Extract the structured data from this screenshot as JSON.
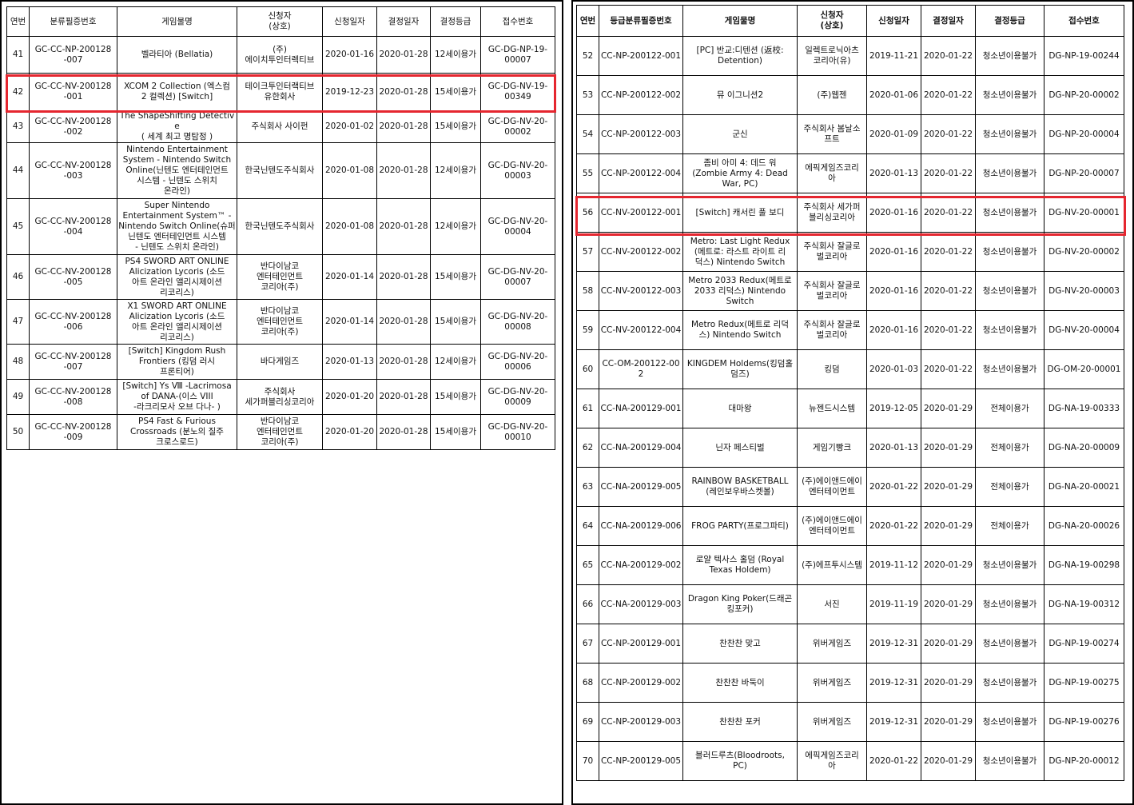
{
  "left": {
    "headers": [
      "연번",
      "분류필증번호",
      "게임물명",
      "신청자\n(상호)",
      "신청일자",
      "결정일자",
      "결정등급",
      "접수번호"
    ],
    "rows": [
      [
        "41",
        "GC-CC-NP-200128\n-007",
        "벨라티아 (Bellatia)",
        "(주)\n에이치투인터렉티브",
        "2020-01-16",
        "2020-01-28",
        "12세이용가",
        "GC-DG-NP-19-\n00007"
      ],
      [
        "42",
        "GC-CC-NV-200128\n-001",
        "XCOM 2 Collection (엑스컴\n2 컬렉션) [Switch]",
        "테이크투인터랙티브\n유한회사",
        "2019-12-23",
        "2020-01-28",
        "15세이용가",
        "GC-DG-NV-19-\n00349"
      ],
      [
        "43",
        "GC-CC-NV-200128\n-002",
        "The ShapeShifting Detective\n( 세계 최고 명탐정 )",
        "주식회사 사이펀",
        "2020-01-02",
        "2020-01-28",
        "15세이용가",
        "GC-DG-NV-20-\n00002"
      ],
      [
        "44",
        "GC-CC-NV-200128\n-003",
        "Nintendo Entertainment\nSystem - Nintendo Switch\nOnline(닌텐도 엔터테인먼트\n시스템 - 닌텐도 스위치\n온라인)",
        "한국닌텐도주식회사",
        "2020-01-08",
        "2020-01-28",
        "12세이용가",
        "GC-DG-NV-20-\n00003"
      ],
      [
        "45",
        "GC-CC-NV-200128\n-004",
        "Super Nintendo\nEntertainment System™ -\nNintendo Switch Online(슈퍼\n닌텐도 엔터테인먼트 시스템\n- 닌텐도 스위치 온라인)",
        "한국닌텐도주식회사",
        "2020-01-08",
        "2020-01-28",
        "12세이용가",
        "GC-DG-NV-20-\n00004"
      ],
      [
        "46",
        "GC-CC-NV-200128\n-005",
        "PS4 SWORD ART ONLINE\nAlicization Lycoris (소드\n아트 온라인 앨리시제이션\n리코리스)",
        "반다이남코\n엔터테인먼트\n코리아(주)",
        "2020-01-14",
        "2020-01-28",
        "15세이용가",
        "GC-DG-NV-20-\n00007"
      ],
      [
        "47",
        "GC-CC-NV-200128\n-006",
        "X1 SWORD ART ONLINE\nAlicization Lycoris (소드\n아트 온라인 앨리시제이션\n리코리스)",
        "반다이남코\n엔터테인먼트\n코리아(주)",
        "2020-01-14",
        "2020-01-28",
        "15세이용가",
        "GC-DG-NV-20-\n00008"
      ],
      [
        "48",
        "GC-CC-NV-200128\n-007",
        "[Switch] Kingdom Rush\nFrontiers (킹덤 러시\n프론티어)",
        "바다게임즈",
        "2020-01-13",
        "2020-01-28",
        "12세이용가",
        "GC-DG-NV-20-\n00006"
      ],
      [
        "49",
        "GC-CC-NV-200128\n-008",
        "[Switch] Ys Ⅷ -Lacrimosa\nof DANA-(이스 VIII\n-라크리모사 오브 다나- )",
        "주식회사\n세가퍼블리싱코리아",
        "2020-01-20",
        "2020-01-28",
        "15세이용가",
        "GC-DG-NV-20-\n00009"
      ],
      [
        "50",
        "GC-CC-NV-200128\n-009",
        "PS4 Fast & Furious\nCrossroads (분노의 질주\n크로스로드)",
        "반다이남코\n엔터테인먼트\n코리아(주)",
        "2020-01-20",
        "2020-01-28",
        "15세이용가",
        "GC-DG-NV-20-\n00010"
      ]
    ]
  },
  "right": {
    "headers": [
      "연번",
      "등급분류필증번호",
      "게임물명",
      "신청자\n(상호)",
      "신청일자",
      "결정일자",
      "결정등급",
      "접수번호"
    ],
    "rows": [
      [
        "52",
        "CC-NP-200122-001",
        "[PC] 반교:디텐션 (返校:\nDetention)",
        "일렉트로닉아츠\n코리아(유)",
        "2019-11-21",
        "2020-01-22",
        "청소년이용불가",
        "DG-NP-19-00244"
      ],
      [
        "53",
        "CC-NP-200122-002",
        "뮤 이그니션2",
        "(주)웹젠",
        "2020-01-06",
        "2020-01-22",
        "청소년이용불가",
        "DG-NP-20-00002"
      ],
      [
        "54",
        "CC-NP-200122-003",
        "군신",
        "주식회사 봄날소\n프트",
        "2020-01-09",
        "2020-01-22",
        "청소년이용불가",
        "DG-NP-20-00004"
      ],
      [
        "55",
        "CC-NP-200122-004",
        "좀비 아미 4: 데드 워\n(Zombie Army 4: Dead\nWar, PC)",
        "에픽게임즈코리\n아",
        "2020-01-13",
        "2020-01-22",
        "청소년이용불가",
        "DG-NP-20-00007"
      ],
      [
        "56",
        "CC-NV-200122-001",
        "[Switch] 캐서린 풀 보디",
        "주식회사 세가퍼\n블리싱코리아",
        "2020-01-16",
        "2020-01-22",
        "청소년이용불가",
        "DG-NV-20-00001"
      ],
      [
        "57",
        "CC-NV-200122-002",
        "Metro: Last Light Redux\n(메트로: 라스트 라이트 리\n덕스) Nintendo Switch",
        "주식회사 잘글로\n벌코리아",
        "2020-01-16",
        "2020-01-22",
        "청소년이용불가",
        "DG-NV-20-00002"
      ],
      [
        "58",
        "CC-NV-200122-003",
        "Metro 2033 Redux(메트로\n2033 리덕스) Nintendo\nSwitch",
        "주식회사 잘글로\n벌코리아",
        "2020-01-16",
        "2020-01-22",
        "청소년이용불가",
        "DG-NV-20-00003"
      ],
      [
        "59",
        "CC-NV-200122-004",
        "Metro Redux(메트로 리덕\n스) Nintendo Switch",
        "주식회사 잘글로\n벌코리아",
        "2020-01-16",
        "2020-01-22",
        "청소년이용불가",
        "DG-NV-20-00004"
      ],
      [
        "60",
        "CC-OM-200122-002",
        "KINGDEM Holdems(킹덤홀\n덤즈)",
        "킹덤",
        "2020-01-03",
        "2020-01-22",
        "청소년이용불가",
        "DG-OM-20-00001"
      ],
      [
        "61",
        "CC-NA-200129-001",
        "대마왕",
        "뉴젠드시스템",
        "2019-12-05",
        "2020-01-29",
        "전체이용가",
        "DG-NA-19-00333"
      ],
      [
        "62",
        "CC-NA-200129-004",
        "닌자 페스티벌",
        "게임기빵크",
        "2020-01-13",
        "2020-01-29",
        "전체이용가",
        "DG-NA-20-00009"
      ],
      [
        "63",
        "CC-NA-200129-005",
        "RAINBOW BASKETBALL\n(레인보우바스켓볼)",
        "(주)에이앤드에이\n엔터테이먼트",
        "2020-01-22",
        "2020-01-29",
        "전체이용가",
        "DG-NA-20-00021"
      ],
      [
        "64",
        "CC-NA-200129-006",
        "FROG PARTY(프로그파티)",
        "(주)에이앤드에이\n엔터테이먼트",
        "2020-01-22",
        "2020-01-29",
        "전체이용가",
        "DG-NA-20-00026"
      ],
      [
        "65",
        "CC-NA-200129-002",
        "로얄 텍사스 홀덤 (Royal\nTexas Holdem)",
        "(주)에프투시스템",
        "2019-11-12",
        "2020-01-29",
        "청소년이용불가",
        "DG-NA-19-00298"
      ],
      [
        "66",
        "CC-NA-200129-003",
        "Dragon King Poker(드래곤\n킹포커)",
        "서진",
        "2019-11-19",
        "2020-01-29",
        "청소년이용불가",
        "DG-NA-19-00312"
      ],
      [
        "67",
        "CC-NP-200129-001",
        "찬찬찬 맞고",
        "위버게임즈",
        "2019-12-31",
        "2020-01-29",
        "청소년이용불가",
        "DG-NP-19-00274"
      ],
      [
        "68",
        "CC-NP-200129-002",
        "찬찬찬 바둑이",
        "위버게임즈",
        "2019-12-31",
        "2020-01-29",
        "청소년이용불가",
        "DG-NP-19-00275"
      ],
      [
        "69",
        "CC-NP-200129-003",
        "찬찬찬 포커",
        "위버게임즈",
        "2019-12-31",
        "2020-01-29",
        "청소년이용불가",
        "DG-NP-19-00276"
      ],
      [
        "70",
        "CC-NP-200129-005",
        "블러드루츠(Bloodroots,\nPC)",
        "에픽게임즈코리\n아",
        "2020-01-22",
        "2020-01-29",
        "청소년이용불가",
        "DG-NP-20-00012"
      ]
    ]
  },
  "colors": {
    "highlight": "#e5262f",
    "border": "#000000"
  }
}
